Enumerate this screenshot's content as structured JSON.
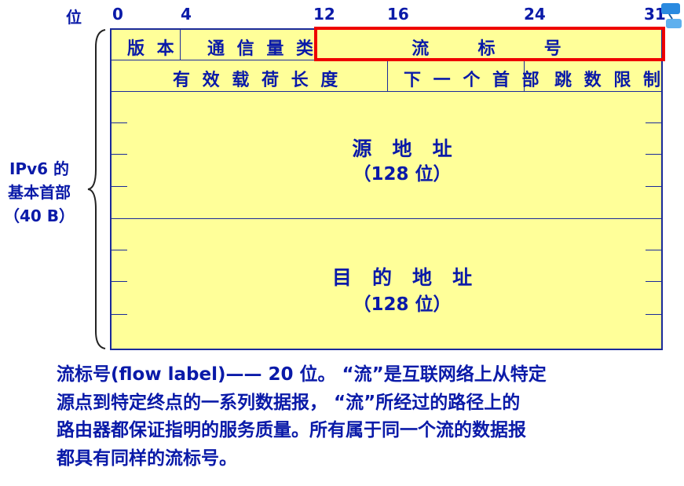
{
  "bit_positions": {
    "label": "位",
    "b0": "0",
    "b4": "4",
    "b12": "12",
    "b16": "16",
    "b24": "24",
    "b31": "31"
  },
  "header_fields": {
    "version": "版 本",
    "traffic_class": "通 信 量 类",
    "flow_label": "流     标     号",
    "payload_length": "有 效 载 荷 长 度",
    "next_header": "下 一 个 首 部",
    "hop_limit": "跳 数 限 制"
  },
  "source": {
    "title": "源   地   址",
    "size": "（128 位）"
  },
  "destination": {
    "title": "目   的   地   址",
    "size": "（128 位）"
  },
  "side_label": {
    "line1": "IPv6 的",
    "line2": "基本首部",
    "line3": "（40 B）"
  },
  "description": {
    "line1": "流标号(flow label)—— 20 位。 “流”是互联网络上从特定",
    "line2": "源点到特定终点的一系列数据报， “流”所经过的路径上的",
    "line3": "路由器都保证指明的服务质量。所有属于同一个流的数据报",
    "line4": "都具有同样的流标号。"
  },
  "colors": {
    "field_fill": "#ffff99",
    "text": "#0a1aa8",
    "highlight": "#ee0000"
  }
}
